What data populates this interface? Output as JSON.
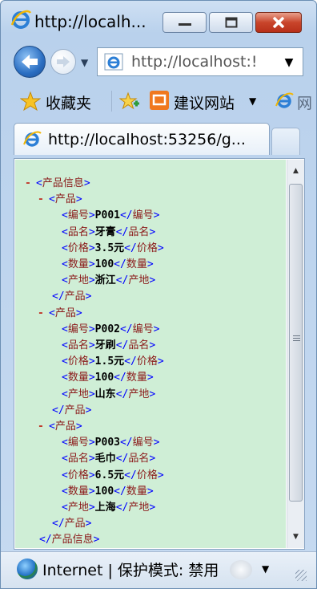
{
  "window": {
    "title": "http://localh..."
  },
  "address_bar": {
    "url": "http://localhost:!"
  },
  "favorites_bar": {
    "favorites_label": "收藏夹",
    "suggested_sites_label": "建议网站",
    "more_label": "网"
  },
  "tab": {
    "title": "http://localhost:53256/g..."
  },
  "xml": {
    "root_tag": "产品信息",
    "item_tag": "产品",
    "field_tags": [
      "编号",
      "品名",
      "价格",
      "数量",
      "产地"
    ],
    "products": [
      {
        "编号": "P001",
        "品名": "牙膏",
        "价格": "3.5元",
        "数量": "100",
        "产地": "浙江"
      },
      {
        "编号": "P002",
        "品名": "牙刷",
        "价格": "1.5元",
        "数量": "100",
        "产地": "山东"
      },
      {
        "编号": "P003",
        "品名": "毛巾",
        "价格": "6.5元",
        "数量": "100",
        "产地": "上海"
      }
    ],
    "collapse_symbol": "-"
  },
  "status_bar": {
    "text": "Internet | 保护模式: 禁用"
  },
  "colors": {
    "xml_background": "#cfeed6",
    "tag_bracket": "#0000ff",
    "tag_name": "#8b1a1a",
    "collapse": "#c0392b"
  }
}
